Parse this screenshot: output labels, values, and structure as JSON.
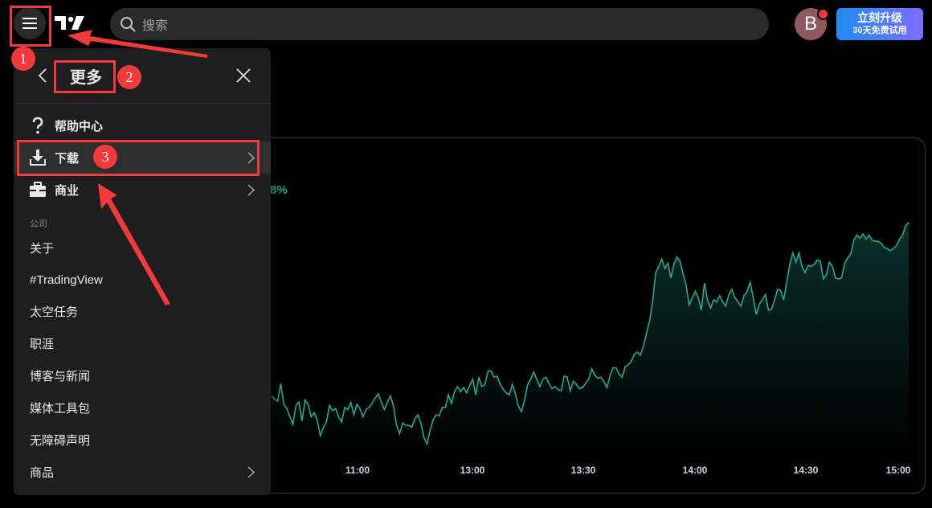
{
  "topbar": {
    "search_placeholder": "搜索",
    "avatar_letter": "B",
    "upgrade_title": "立刻升级",
    "upgrade_sub": "30天免费试用"
  },
  "chart": {
    "change_text": "8%",
    "line_color": "#22ab94"
  },
  "chart_data": {
    "type": "area",
    "x_tick_labels": [
      "11:00",
      "13:00",
      "13:30",
      "14:00",
      "14:30",
      "15:00"
    ],
    "y": [
      58,
      55,
      53,
      70,
      50,
      46,
      38,
      31,
      49,
      52,
      34,
      54,
      50,
      38,
      42,
      35,
      20,
      28,
      33,
      49,
      44,
      46,
      38,
      33,
      47,
      45,
      52,
      40,
      50,
      46,
      38,
      45,
      47,
      51,
      56,
      60,
      52,
      45,
      52,
      58,
      48,
      30,
      22,
      32,
      30,
      30,
      28,
      36,
      40,
      32,
      18,
      12,
      25,
      35,
      40,
      39,
      47,
      47,
      59,
      51,
      62,
      67,
      62,
      66,
      61,
      68,
      74,
      59,
      76,
      67,
      69,
      82,
      82,
      76,
      77,
      69,
      64,
      61,
      59,
      69,
      60,
      48,
      43,
      54,
      69,
      74,
      81,
      74,
      67,
      74,
      76,
      70,
      65,
      67,
      64,
      63,
      77,
      76,
      63,
      72,
      69,
      65,
      66,
      70,
      74,
      84,
      78,
      75,
      76,
      72,
      66,
      77,
      85,
      85,
      79,
      76,
      86,
      88,
      91,
      98,
      100,
      97,
      106,
      118,
      130,
      148,
      176,
      182,
      189,
      180,
      185,
      171,
      184,
      191,
      187,
      175,
      164,
      145,
      152,
      158,
      152,
      140,
      166,
      150,
      142,
      150,
      148,
      154,
      148,
      144,
      155,
      160,
      152,
      148,
      144,
      154,
      158,
      167,
      152,
      136,
      146,
      150,
      155,
      140,
      141,
      150,
      160,
      159,
      150,
      167,
      184,
      195,
      186,
      195,
      182,
      176,
      183,
      182,
      184,
      188,
      187,
      170,
      174,
      186,
      182,
      171,
      170,
      171,
      185,
      190,
      194,
      207,
      212,
      209,
      213,
      208,
      212,
      207,
      206,
      206,
      204,
      200,
      199,
      197,
      199,
      202,
      208,
      212,
      221,
      224
    ]
  },
  "menu": {
    "title": "更多",
    "items": [
      {
        "label": "帮助中心"
      },
      {
        "label": "下载"
      },
      {
        "label": "商业"
      }
    ],
    "section_label": "公司",
    "company_items": [
      {
        "label": "关于"
      },
      {
        "label": "#TradingView"
      },
      {
        "label": "太空任务"
      },
      {
        "label": "职涯"
      },
      {
        "label": "博客与新闻"
      },
      {
        "label": "媒体工具包"
      },
      {
        "label": "无障碍声明"
      },
      {
        "label": "商品"
      }
    ]
  },
  "annotations": {
    "badge_1": "1",
    "badge_2": "2",
    "badge_3": "3",
    "color": "#f23a3a"
  }
}
